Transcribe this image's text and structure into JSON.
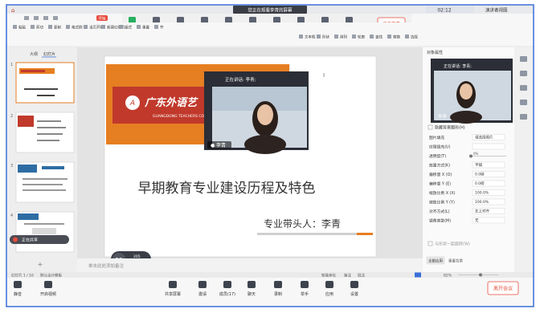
{
  "meeting": {
    "share_banner": "您正在观看李青的屏幕",
    "time": "02:12",
    "view_mode": "演讲者视图",
    "top_buttons": [
      {
        "label": "麦克",
        "icon": "mic-icon"
      },
      {
        "label": "停止视频",
        "icon": "camera-icon"
      },
      {
        "label": "成员(17)",
        "icon": "members-icon"
      },
      {
        "label": "聊天",
        "icon": "chat-icon"
      },
      {
        "label": "更多",
        "icon": "more-icon"
      },
      {
        "label": "新的共享",
        "icon": "new-share-icon"
      },
      {
        "label": "暂停共享",
        "icon": "pause-share-icon"
      },
      {
        "label": "互动批注",
        "icon": "annotate-icon"
      },
      {
        "label": "远程控制",
        "icon": "remote-control-icon"
      },
      {
        "label": "幻灯片模板",
        "icon": "slides-icon"
      }
    ],
    "end_share_button": "结束共享",
    "speaking_label": "正在讲话: 李青;",
    "video_name": "李青",
    "side_speaking_label": "正在讲话: 李青;",
    "side_video_name": "李青",
    "bottom_toolbar": [
      {
        "label": "静音",
        "icon": "mic-icon"
      },
      {
        "label": "开启视频",
        "icon": "camera-off-icon"
      },
      {
        "label": "共享屏幕",
        "icon": "share-screen-icon"
      },
      {
        "label": "邀请",
        "icon": "invite-icon"
      },
      {
        "label": "成员(17)",
        "icon": "members-icon"
      },
      {
        "label": "聊天",
        "icon": "chat-icon"
      },
      {
        "label": "录制",
        "icon": "record-icon"
      },
      {
        "label": "举手",
        "icon": "raise-hand-icon"
      },
      {
        "label": "应用",
        "icon": "apps-icon"
      },
      {
        "label": "设置",
        "icon": "settings-icon"
      }
    ],
    "leave_button": "离开会议",
    "network": {
      "value": "53",
      "unit": "%",
      "up": "205",
      "down": "3.7"
    },
    "share_status": "正在共享"
  },
  "wps": {
    "quick_toolbar_start": "开始",
    "ribbon_row1": [
      "粘贴",
      "剪切",
      "复制",
      "格式刷",
      "当页开始",
      "新建幻灯片",
      "版式",
      "重置",
      "节"
    ],
    "ribbon_row2_right": [
      "文本框",
      "形状",
      "排列",
      "轮廓",
      "查找",
      "替换",
      "选择"
    ],
    "panel_tabs": [
      "大纲",
      "幻灯片"
    ],
    "status_bar": [
      "幻灯片 1 / 16",
      "默认设计模板"
    ],
    "notes_placeholder": "单击此处添加备注",
    "status_right": [
      "智能美化",
      "备注",
      "批注"
    ],
    "zoom_value": "82%"
  },
  "slide": {
    "logo_text": "广东外语艺",
    "logo_subtext": "GUANGDONG TEACHERS COLLE",
    "title": "早期教育专业建设历程及特色",
    "subtitle": "专业带头人：李青"
  },
  "property_panel": {
    "header": "对象属性",
    "hide_background_label": "隐藏背景图形(H)",
    "rows": [
      {
        "label": "图片填充",
        "value": "请选择图片"
      },
      {
        "label": "纹理填充(U)",
        "value": ""
      },
      {
        "label": "透明度(T)",
        "value": "0%"
      },
      {
        "label": "放置方式(K)",
        "value": "平铺"
      },
      {
        "label": "偏移量 X (O)",
        "value": "0.0磅"
      },
      {
        "label": "偏移量 Y (E)",
        "value": "0.0磅"
      },
      {
        "label": "缩放比例 X (X)",
        "value": "100.0%"
      },
      {
        "label": "缩放比例 Y (Y)",
        "value": "100.0%"
      },
      {
        "label": "对齐方式(L)",
        "value": "左上对齐"
      },
      {
        "label": "镜像类型(M)",
        "value": "无"
      }
    ],
    "rotate_label": "与形状一起旋转(W)",
    "apply_all_button": "全部应用",
    "reset_background_button": "重置背景"
  }
}
